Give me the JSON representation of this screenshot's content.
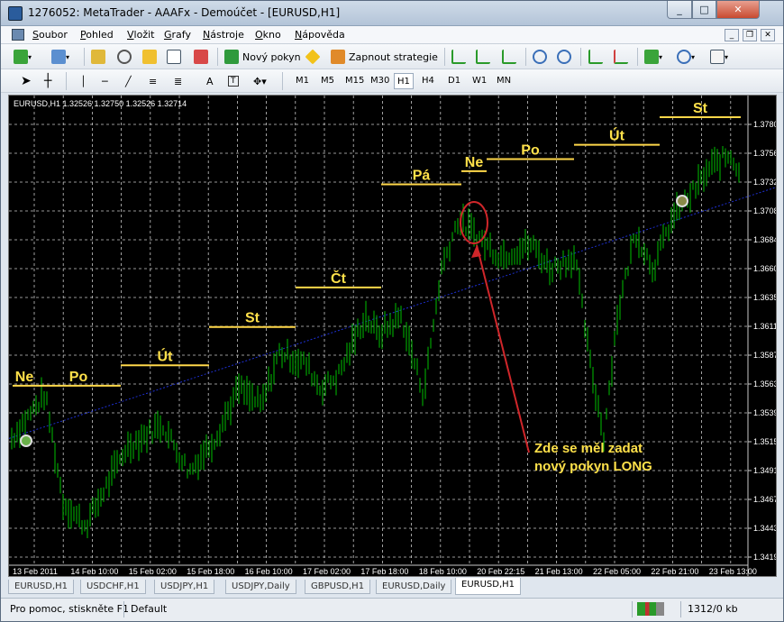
{
  "window": {
    "title": "1276052: MetaTrader - AAAFx - Demoúčet - [EURUSD,H1]",
    "minimize": "_",
    "maximize": "□",
    "close": "✕"
  },
  "menu": [
    "Soubor",
    "Pohled",
    "Vložit",
    "Grafy",
    "Nástroje",
    "Okno",
    "Nápověda"
  ],
  "toolbar": {
    "new_order": "Nový pokyn",
    "strategy": "Zapnout strategie"
  },
  "draw_tools": [
    "A"
  ],
  "timeframes": [
    {
      "label": "M1"
    },
    {
      "label": "M5"
    },
    {
      "label": "M15"
    },
    {
      "label": "M30"
    },
    {
      "label": "H1",
      "active": true
    },
    {
      "label": "H4"
    },
    {
      "label": "D1"
    },
    {
      "label": "W1"
    },
    {
      "label": "MN"
    }
  ],
  "chart": {
    "info": "EURUSD,H1  1.32526 1.32750 1.32526 1.32714",
    "annotation_line1": "Zde se měl zadat",
    "annotation_line2": "nový pokyn LONG",
    "colors": {
      "bg": "#000000",
      "candle": "#00c000",
      "grid": "#c8c8c8",
      "day_line": "#ffd84a",
      "annotation": "#ffe14a",
      "circle": "#d0262a",
      "trend": "#1d2fd0"
    }
  },
  "chart_data": {
    "type": "line",
    "symbol": "EURUSD",
    "timeframe": "H1",
    "y_ticks": [
      "1.37800",
      "1.37560",
      "1.37320",
      "1.37080",
      "1.36840",
      "1.36600",
      "1.36355",
      "1.36115",
      "1.35875",
      "1.35635",
      "1.35395",
      "1.35155",
      "1.34910",
      "1.34670",
      "1.34430",
      "1.34190"
    ],
    "x_ticks": [
      "13 Feb 2011",
      "14 Feb 10:00",
      "15 Feb 02:00",
      "15 Feb 18:00",
      "16 Feb 10:00",
      "17 Feb 02:00",
      "17 Feb 18:00",
      "18 Feb 10:00",
      "20 Feb 22:15",
      "21 Feb 13:00",
      "22 Feb 05:00",
      "22 Feb 21:00",
      "23 Feb 13:00"
    ],
    "ylim": [
      1.3419,
      1.378
    ],
    "day_labels": [
      {
        "label": "Ne",
        "price": 1.3562
      },
      {
        "label": "Po",
        "price": 1.3562
      },
      {
        "label": "Út",
        "price": 1.3579
      },
      {
        "label": "St",
        "price": 1.3611
      },
      {
        "label": "Čt",
        "price": 1.3644
      },
      {
        "label": "Pá",
        "price": 1.373
      },
      {
        "label": "Ne",
        "price": 1.3741
      },
      {
        "label": "Po",
        "price": 1.3751
      },
      {
        "label": "Út",
        "price": 1.3763
      },
      {
        "label": "St",
        "price": 1.3786
      }
    ]
  },
  "tabs": [
    "EURUSD,H1",
    "USDCHF,H1",
    "USDJPY,H1",
    "USDJPY,Daily",
    "GBPUSD,H1",
    "EURUSD,Daily",
    "EURUSD,H1"
  ],
  "active_tab": 6,
  "status": {
    "help": "Pro pomoc, stiskněte F1",
    "profile": "Default",
    "traffic": "1312/0 kb"
  }
}
